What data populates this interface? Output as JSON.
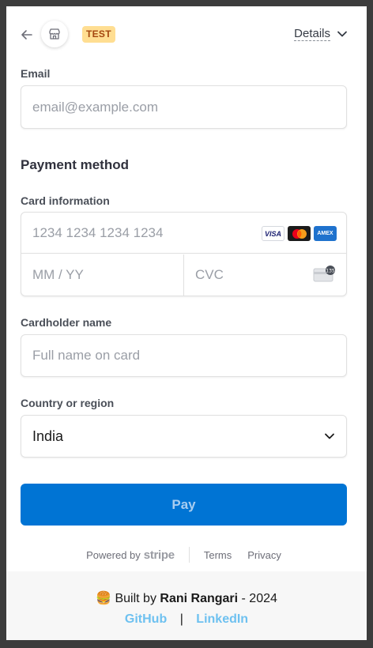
{
  "header": {
    "test_badge": "TEST",
    "details_label": "Details",
    "back_icon": "arrow-left-icon",
    "store_icon": "storefront-icon"
  },
  "email": {
    "label": "Email",
    "placeholder": "email@example.com"
  },
  "payment": {
    "section_title": "Payment method",
    "card_label": "Card information",
    "card_number_placeholder": "1234 1234 1234 1234",
    "expiry_placeholder": "MM / YY",
    "cvc_placeholder": "CVC",
    "cvc_badge": "135",
    "brands": [
      "VISA",
      "Mastercard",
      "AMEX"
    ],
    "cardholder_label": "Cardholder name",
    "cardholder_placeholder": "Full name on card",
    "country_label": "Country or region",
    "country_value": "India",
    "pay_label": "Pay"
  },
  "powered": {
    "powered_by": "Powered by",
    "brand": "stripe",
    "terms": "Terms",
    "privacy": "Privacy"
  },
  "footer": {
    "emoji": "🍔",
    "built_by": "Built by",
    "author": "Rani Rangari",
    "year_suffix": "- 2024",
    "github": "GitHub",
    "separator": "|",
    "linkedin": "LinkedIn"
  },
  "colors": {
    "primary": "#0074d4",
    "test_badge_bg": "#ffde92",
    "test_badge_text": "#a4470f",
    "footer_link": "#6ec1f0"
  }
}
